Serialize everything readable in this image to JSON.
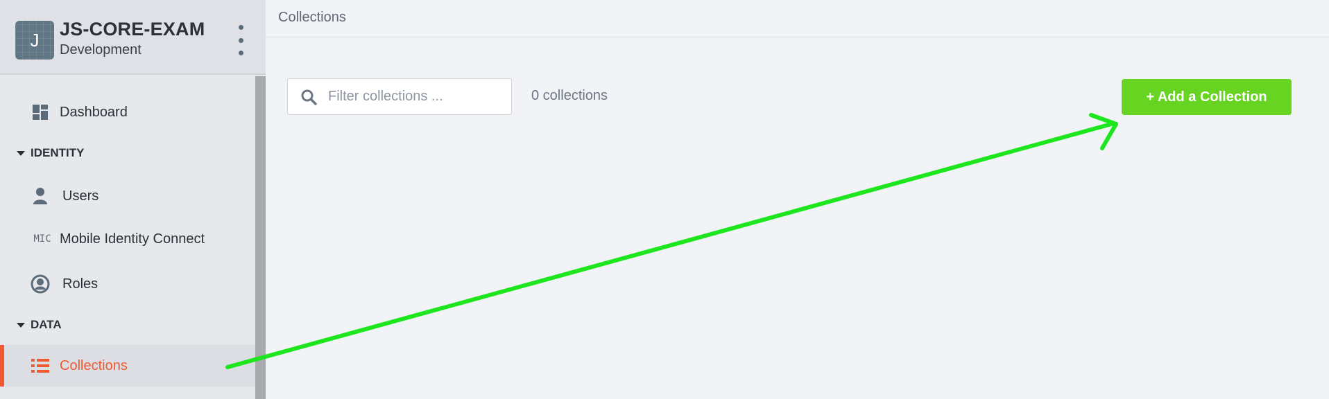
{
  "app": {
    "logo_letter": "J",
    "name": "JS-CORE-EXAM",
    "environment": "Development"
  },
  "sidebar": {
    "dashboard": "Dashboard",
    "sections": {
      "identity": "IDENTITY",
      "data": "DATA"
    },
    "users": "Users",
    "mic_icon_text": "MIC",
    "mic": "Mobile Identity Connect",
    "roles": "Roles",
    "collections": "Collections"
  },
  "topbar": {
    "breadcrumb": "Collections"
  },
  "main": {
    "search_placeholder": "Filter collections ...",
    "count": "0 collections",
    "add_button": "+ Add a Collection"
  },
  "colors": {
    "accent": "#f05a33",
    "add_button": "#66d420",
    "annotation_arrow": "#1ee61e"
  },
  "icons": {
    "dashboard": "dashboard-icon",
    "users": "user-icon",
    "roles": "roles-icon",
    "collections": "list-icon",
    "search": "search-icon",
    "menu": "kebab-menu-icon"
  }
}
